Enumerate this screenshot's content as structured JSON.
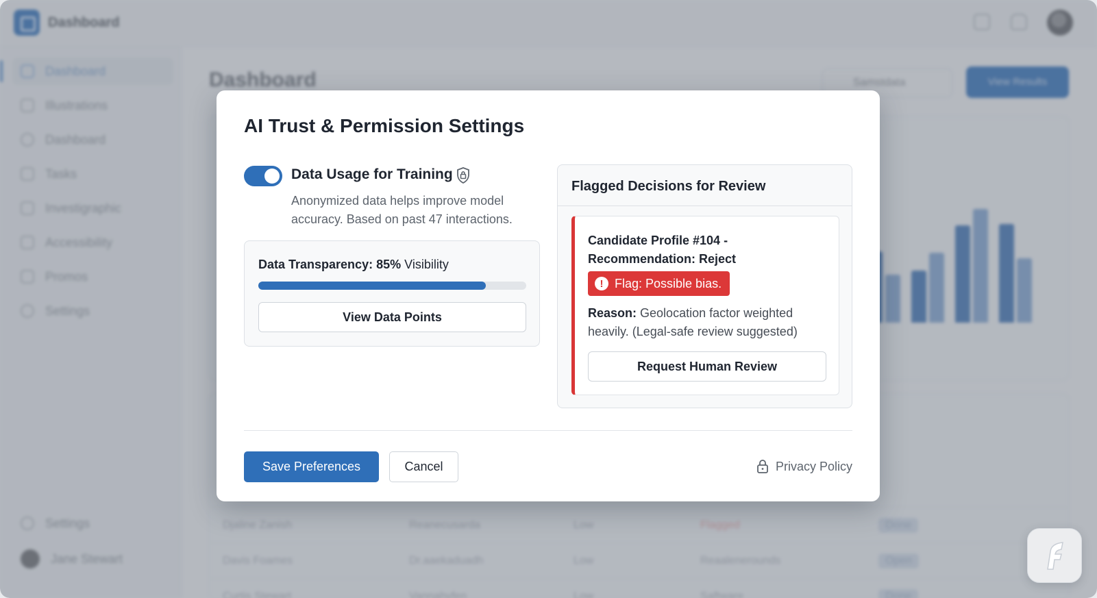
{
  "app": {
    "title": "Dashboard",
    "page_title": "Dashboard",
    "select_label": "Samstdata",
    "action_button": "View Results",
    "sidebar": [
      {
        "label": "Dashboard",
        "active": true
      },
      {
        "label": "Illustrations"
      },
      {
        "label": "Dashboard"
      },
      {
        "label": "Tasks"
      },
      {
        "label": "Investigraphic"
      },
      {
        "label": "Accessibility"
      },
      {
        "label": "Promos"
      },
      {
        "label": "Settings"
      }
    ],
    "sidebar_footer": {
      "settings": "Settings",
      "user": "Jane Stewart"
    },
    "table_rows": [
      [
        "Djaline Zanish",
        "Reanecusarda",
        "Low",
        "Flagged",
        "Done"
      ],
      [
        "Davis Foames",
        "Dr.aaekaduadh",
        "Low",
        "Reaalenerounds",
        "Open"
      ],
      [
        "Curtis Stewart",
        "Vannahvfen",
        "Low",
        "Saftware",
        "Done"
      ]
    ]
  },
  "modal": {
    "title": "AI Trust & Permission Settings",
    "data_usage": {
      "label": "Data Usage for Training",
      "enabled": true,
      "description": "Anonymized data helps improve model accuracy. Based on past 47 interactions."
    },
    "transparency": {
      "label_bold": "Data Transparency:",
      "percent_text": "85%",
      "label_suffix": "Visibility",
      "value": 0.85,
      "button": "View Data Points"
    },
    "flagged": {
      "header": "Flagged Decisions for Review",
      "candidate": "Candidate Profile #104 - Recommendation: Reject",
      "flag": "Flag: Possible bias.",
      "reason_label": "Reason:",
      "reason_text": "Geolocation factor weighted heavily. (Legal-safe review suggested)",
      "button": "Request Human Review"
    },
    "footer": {
      "save": "Save Preferences",
      "cancel": "Cancel",
      "privacy": "Privacy Policy"
    }
  },
  "colors": {
    "primary": "#2f6fb8",
    "danger": "#dc3838"
  }
}
